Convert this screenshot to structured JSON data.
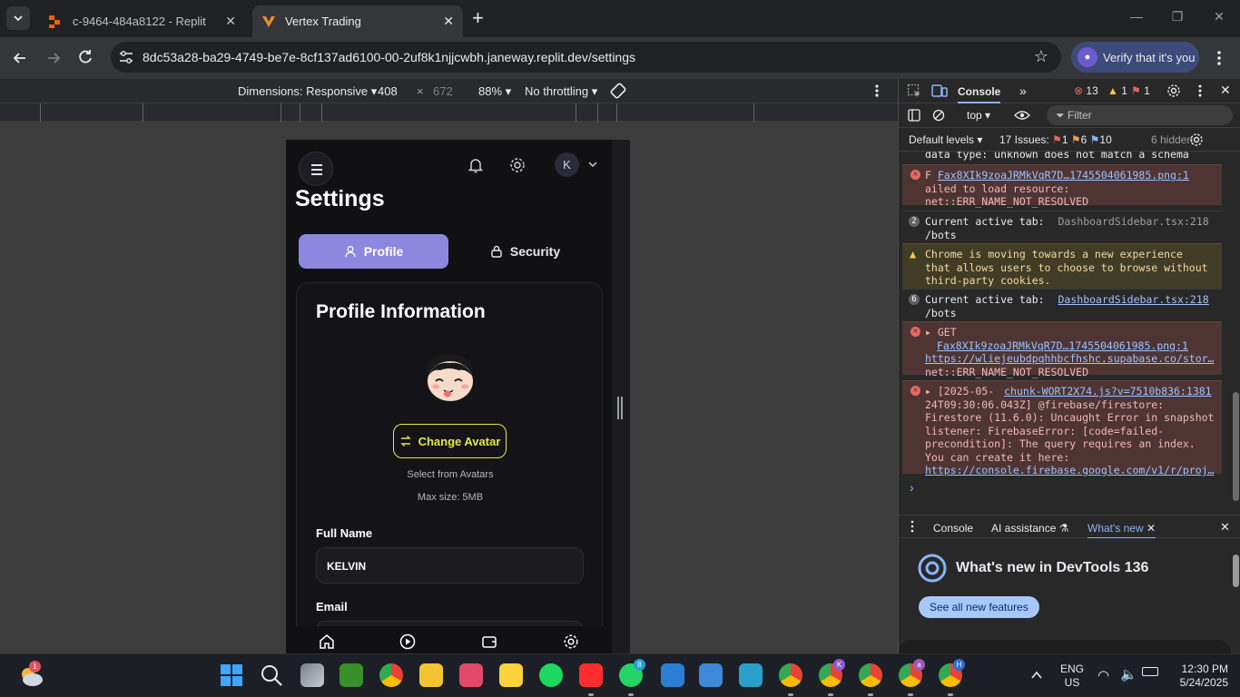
{
  "browser": {
    "tabs": [
      {
        "title": "c-9464-484a8122 - Replit",
        "active": false
      },
      {
        "title": "Vertex Trading",
        "active": true
      }
    ],
    "url": "8dc53a28-ba29-4749-be7e-8cf137ad6100-00-2uf8k1njjcwbh.janeway.replit.dev/settings",
    "verify_label": "Verify that it's you"
  },
  "device_toolbar": {
    "dimensions_label": "Dimensions: Responsive",
    "width": "408",
    "times": "×",
    "height": "672",
    "zoom": "88%",
    "throttling": "No throttling"
  },
  "app": {
    "avatar_initial": "K",
    "page_title": "Settings",
    "tabs": {
      "profile": "Profile",
      "security": "Security"
    },
    "card_title": "Profile Information",
    "change_avatar": "Change Avatar",
    "select_hint": "Select from Avatars",
    "max_size": "Max size: 5MB",
    "full_name_label": "Full Name",
    "full_name_value": "KELVIN",
    "email_label": "Email"
  },
  "devtools": {
    "active_tab": "Console",
    "error_count": "13",
    "warning_count": "1",
    "issue_flag_count": "1",
    "context": "top",
    "filter_placeholder": "Filter",
    "levels": "Default levels",
    "issues_label": "17 Issues:",
    "issues_errors": "1",
    "issues_warnings": "6",
    "issues_info": "10",
    "hidden": "6 hidden",
    "messages": {
      "m0": "data type: unknown does not match a schema",
      "m1_prefix": "F",
      "m1_link": "Fax8XIk9zoaJRMkVqR7D…1745504061985.png:1",
      "m1_text1": "ailed to load resource:",
      "m1_text2": "net::ERR_NAME_NOT_RESOLVED",
      "m2_count": "2",
      "m2_text": "Current active tab:",
      "m2_src": "DashboardSidebar.tsx:218",
      "m2_text2": "/bots",
      "m3_l1": "Chrome is moving towards a new experience",
      "m3_l2": "that allows users to choose to browse without",
      "m3_l3": "third-party cookies.",
      "m4_count": "6",
      "m4_text": "Current active tab:",
      "m4_src": "DashboardSidebar.tsx:218",
      "m4_text2": "/bots",
      "m5_get": "GET",
      "m5_link1": "Fax8XIk9zoaJRMkVqR7D…1745504061985.png:1",
      "m5_link2": "https://wliejeubdpqhhbcfhshc.supabase.co/stor…",
      "m5_text": "net::ERR_NAME_NOT_RESOLVED",
      "m6_l1": "[2025-05-",
      "m6_src": "chunk-WORT2X74.js?v=7510b836:1381",
      "m6_l2": "24T09:30:06.043Z]  @firebase/firestore:",
      "m6_l3": "Firestore (11.6.0): Uncaught Error in snapshot",
      "m6_l4": "listener: FirebaseError: [code=failed-",
      "m6_l5": "precondition]: The query requires an index.",
      "m6_l6": "You can create it here:",
      "m6_link": "https://console.firebase.google.com/v1/r/proj…"
    },
    "drawer_tabs": {
      "console": "Console",
      "ai": "AI assistance",
      "whats_new": "What's new"
    },
    "whats_new_title": "What's new in DevTools 136",
    "see_all": "See all new features"
  },
  "taskbar": {
    "weather_badge": "1",
    "whatsapp_badge": "8",
    "lang": "ENG",
    "region": "US",
    "time": "12:30 PM",
    "date": "5/24/2025",
    "profile_k": "K",
    "profile_a": "a",
    "profile_h": "H"
  },
  "colors": {
    "accent_purple": "#8e87e0",
    "avatar_button_border": "#e6e64a",
    "error_red": "#e46962",
    "warn_yellow": "#f2c94c"
  }
}
